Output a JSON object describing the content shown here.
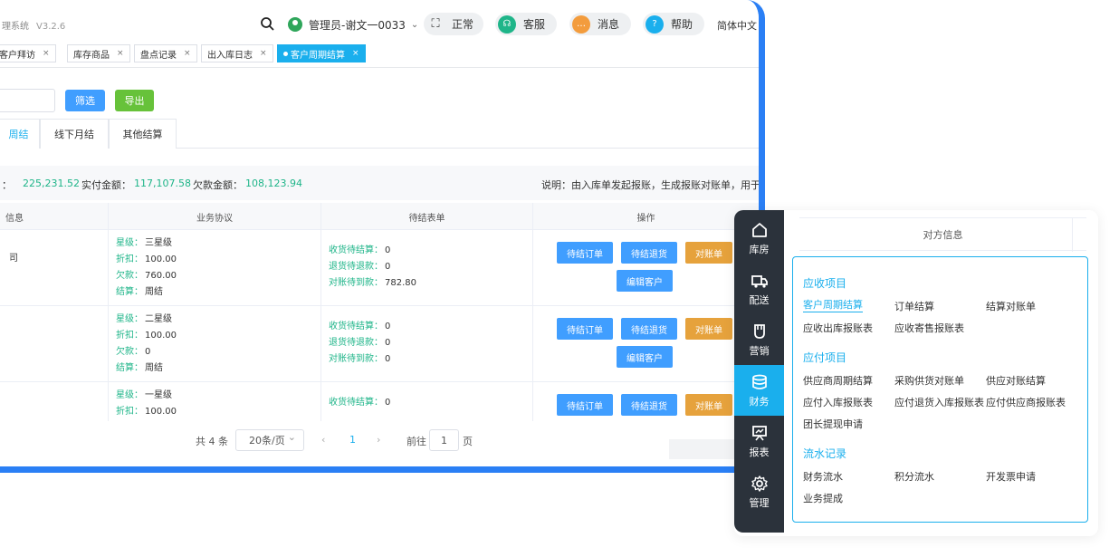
{
  "app": {
    "name": "理系统",
    "version": "V3.2.6"
  },
  "topbar": {
    "user": "管理员-谢文一0033",
    "normal": "正常",
    "customer_service": "客服",
    "messages": "消息",
    "help": "帮助",
    "language": "简体中文"
  },
  "tabs": [
    {
      "label": "客户拜访"
    },
    {
      "label": "库存商品"
    },
    {
      "label": "盘点记录"
    },
    {
      "label": "出入库日志"
    },
    {
      "label": "客户周期结算"
    }
  ],
  "toolbar": {
    "filter": "筛选",
    "export": "导出"
  },
  "subtabs": [
    {
      "label": "周结"
    },
    {
      "label": "线下月结"
    },
    {
      "label": "其他结算"
    }
  ],
  "summary": {
    "total_value": "225,231.52",
    "paid_label": "实付金额：",
    "paid_value": "117,107.58",
    "owed_label": "欠款金额：",
    "owed_value": "108,123.94",
    "note": "说明：由入库单发起报账，生成报账对账单，用于跟刻"
  },
  "table": {
    "headers": [
      "信息",
      "业务协议",
      "待结表单",
      "操作"
    ],
    "rows": [
      {
        "name": "司",
        "level": "三星级",
        "discount": "100.00",
        "debt": "760.00",
        "settle": "周结",
        "recv": "0",
        "ret": "0",
        "reconcile": "782.80"
      },
      {
        "name": "",
        "level": "二星级",
        "discount": "100.00",
        "debt": "0",
        "settle": "周结",
        "recv": "0",
        "ret": "0",
        "reconcile": "0"
      },
      {
        "name": "",
        "level": "一星级",
        "discount": "100.00",
        "recv": "0"
      }
    ],
    "labels": {
      "level": "星级：",
      "discount": "折扣：",
      "debt": "欠款：",
      "settle": "结算：",
      "recv": "收货待结算：",
      "ret": "退货待退款：",
      "reconcile": "对账待到款："
    },
    "actions": {
      "pending_order": "待结订单",
      "pending_return": "待结退货",
      "statement": "对账单",
      "edit_customer": "编辑客户"
    }
  },
  "pager": {
    "total": "共 4 条",
    "page_size": "20条/页",
    "current": "1",
    "goto_label": "前往",
    "goto_value": "1",
    "page_unit": "页"
  },
  "sidenav": {
    "items": [
      {
        "label": "库房",
        "icon": "house-icon"
      },
      {
        "label": "配送",
        "icon": "truck-icon"
      },
      {
        "label": "营销",
        "icon": "cup-icon"
      },
      {
        "label": "财务",
        "icon": "database-icon"
      },
      {
        "label": "报表",
        "icon": "board-icon"
      },
      {
        "label": "管理",
        "icon": "gear-icon"
      }
    ],
    "active": "财务"
  },
  "panel": {
    "header": "对方信息",
    "sections": [
      {
        "title": "应收项目",
        "items": [
          "客户周期结算",
          "订单结算",
          "结算对账单",
          "应收出库报账表",
          "应收寄售报账表"
        ]
      },
      {
        "title": "应付项目",
        "items": [
          "供应商周期结算",
          "采购供货对账单",
          "供应对账结算",
          "应付入库报账表",
          "应付退货入库报账表",
          "应付供应商报账表",
          "团长提现申请"
        ]
      },
      {
        "title": "流水记录",
        "items": [
          "财务流水",
          "积分流水",
          "开发票申请",
          "业务提成"
        ]
      }
    ]
  },
  "colors": {
    "accent": "#1aafed",
    "frame": "#2a7ff5",
    "green": "#1fb589",
    "orange": "#e6a23c",
    "blue": "#409eff",
    "dark": "#2b323b"
  }
}
